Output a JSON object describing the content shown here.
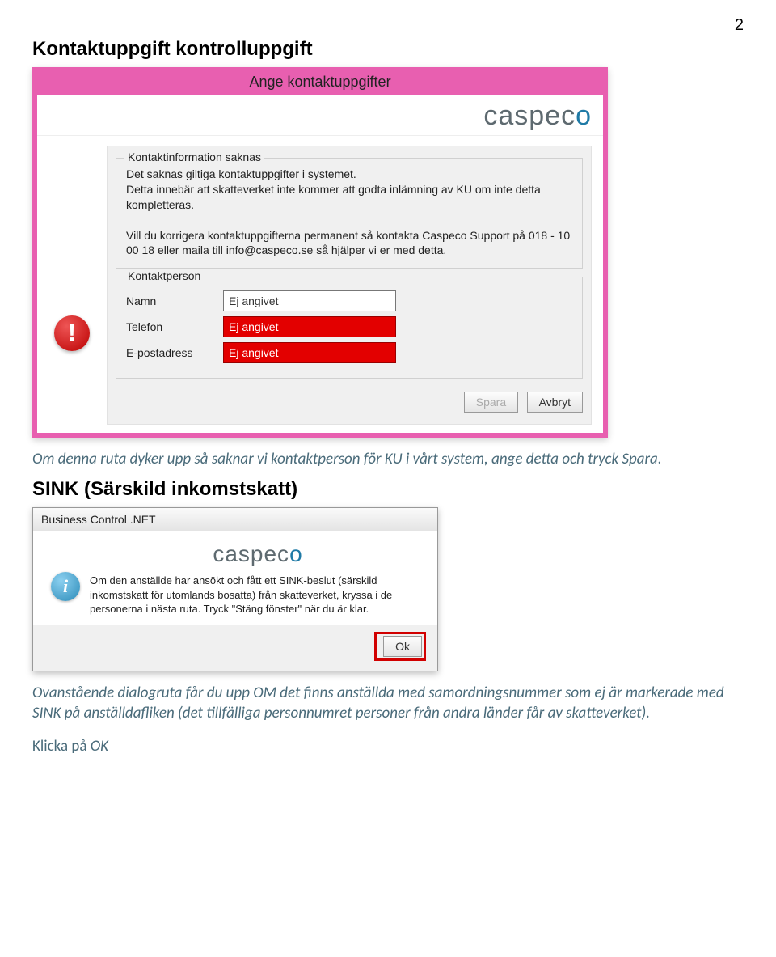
{
  "page_number": "2",
  "heading1": "Kontaktuppgift kontrolluppgift",
  "dialog1": {
    "title": "Ange kontaktuppgifter",
    "logo": "caspeco",
    "info_group": {
      "legend": "Kontaktinformation saknas",
      "text": "Det saknas giltiga kontaktuppgifter i systemet.\nDetta innebär att skatteverket inte kommer att godta inlämning av KU om inte detta kompletteras.\n\nVill du korrigera kontaktuppgifterna permanent så kontakta Caspeco Support på 018 - 10 00 18 eller maila till info@caspeco.se så hjälper vi er med detta."
    },
    "contact_group": {
      "legend": "Kontaktperson",
      "rows": [
        {
          "label": "Namn",
          "value": "Ej angivet",
          "error": false
        },
        {
          "label": "Telefon",
          "value": "Ej angivet",
          "error": true
        },
        {
          "label": "E-postadress",
          "value": "Ej angivet",
          "error": true
        }
      ]
    },
    "buttons": {
      "save": "Spara",
      "cancel": "Avbryt"
    }
  },
  "caption1_a": "Om denna ruta dyker upp så saknar vi kontaktperson för KU i vårt system, ange detta och tryck ",
  "caption1_b": "Spara.",
  "heading2": "SINK (Särskild inkomstskatt)",
  "dialog2": {
    "title": "Business Control .NET",
    "logo": "caspeco",
    "text": "Om den anställde har ansökt och fått ett SINK-beslut (särskild inkomstskatt för utomlands bosatta) från skatteverket, kryssa i de personerna i nästa ruta. Tryck \"Stäng fönster\" när du är klar.",
    "ok": "Ok"
  },
  "caption2": "Ovanstående dialogruta får du upp OM det finns anställda med samordningsnummer som ej är markerade med SINK på anställdafliken (det tillfälliga personnumret personer från andra länder får av skatteverket).",
  "footer_a": "Klicka på  ",
  "footer_b": "OK"
}
